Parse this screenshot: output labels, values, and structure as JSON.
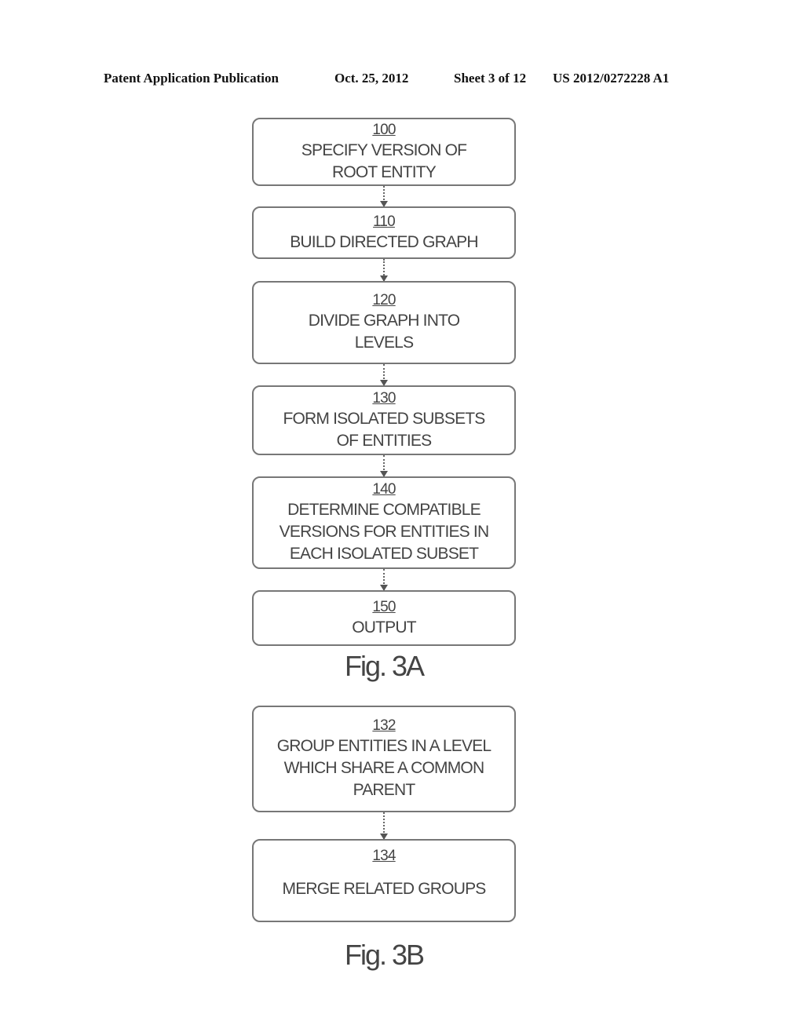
{
  "header": {
    "publication": "Patent Application Publication",
    "date": "Oct. 25, 2012",
    "sheet": "Sheet 3 of 12",
    "number": "US 2012/0272228 A1"
  },
  "fig3a": {
    "label": "Fig. 3A",
    "steps": [
      {
        "ref": "100",
        "text": "SPECIFY VERSION OF\nROOT ENTITY"
      },
      {
        "ref": "110",
        "text": "BUILD DIRECTED GRAPH"
      },
      {
        "ref": "120",
        "text": "DIVIDE GRAPH INTO\nLEVELS"
      },
      {
        "ref": "130",
        "text": "FORM ISOLATED SUBSETS\nOF ENTITIES"
      },
      {
        "ref": "140",
        "text": "DETERMINE COMPATIBLE\nVERSIONS FOR ENTITIES IN\nEACH ISOLATED SUBSET"
      },
      {
        "ref": "150",
        "text": "OUTPUT"
      }
    ]
  },
  "fig3b": {
    "label": "Fig. 3B",
    "steps": [
      {
        "ref": "132",
        "text": "GROUP ENTITIES IN A LEVEL\nWHICH SHARE A COMMON\nPARENT"
      },
      {
        "ref": "134",
        "text": "MERGE RELATED GROUPS"
      }
    ]
  }
}
